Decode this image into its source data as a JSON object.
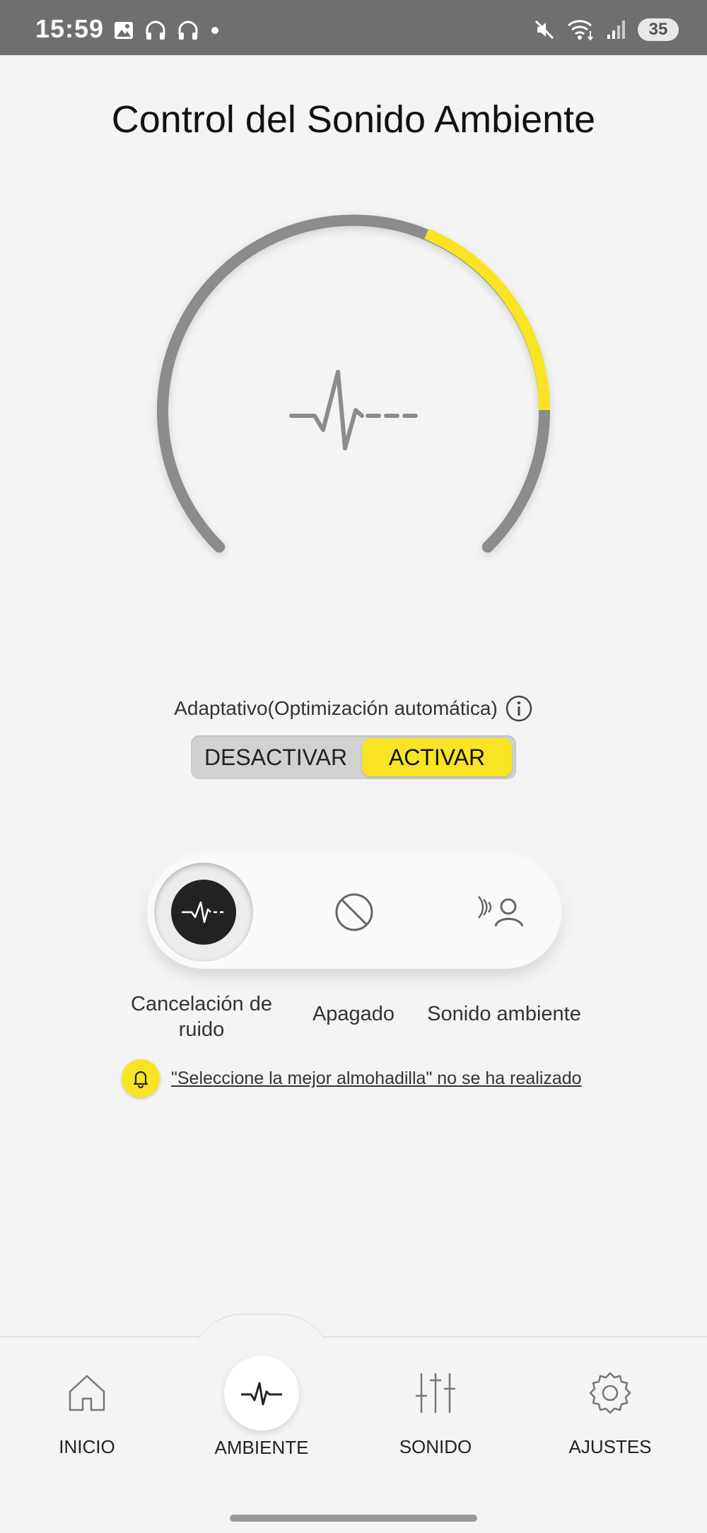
{
  "status_bar": {
    "time": "15:59",
    "battery": "35"
  },
  "page": {
    "title": "Control del Sonido Ambiente"
  },
  "adaptive": {
    "label": "Adaptativo(Optimización automática)",
    "off_label": "DESACTIVAR",
    "on_label": "ACTIVAR",
    "selected": "ACTIVAR"
  },
  "dial": {
    "level_fraction": 0.25,
    "track_color": "#8c8c8c",
    "active_color": "#f8e424"
  },
  "modes": [
    {
      "label": "Cancelación de ruido",
      "active": true
    },
    {
      "label": "Apagado",
      "active": false
    },
    {
      "label": "Sonido ambiente",
      "active": false
    }
  ],
  "notice": {
    "text": "\"Seleccione la mejor almohadilla\" no se ha realizado"
  },
  "nav": [
    {
      "label": "INICIO",
      "icon": "home-icon"
    },
    {
      "label": "AMBIENTE",
      "icon": "waveform-icon",
      "active": true
    },
    {
      "label": "SONIDO",
      "icon": "equalizer-icon"
    },
    {
      "label": "AJUSTES",
      "icon": "gear-icon"
    }
  ],
  "colors": {
    "accent": "#f8e424",
    "background": "#f4f4f4",
    "status_bar": "#6f6f6f"
  }
}
